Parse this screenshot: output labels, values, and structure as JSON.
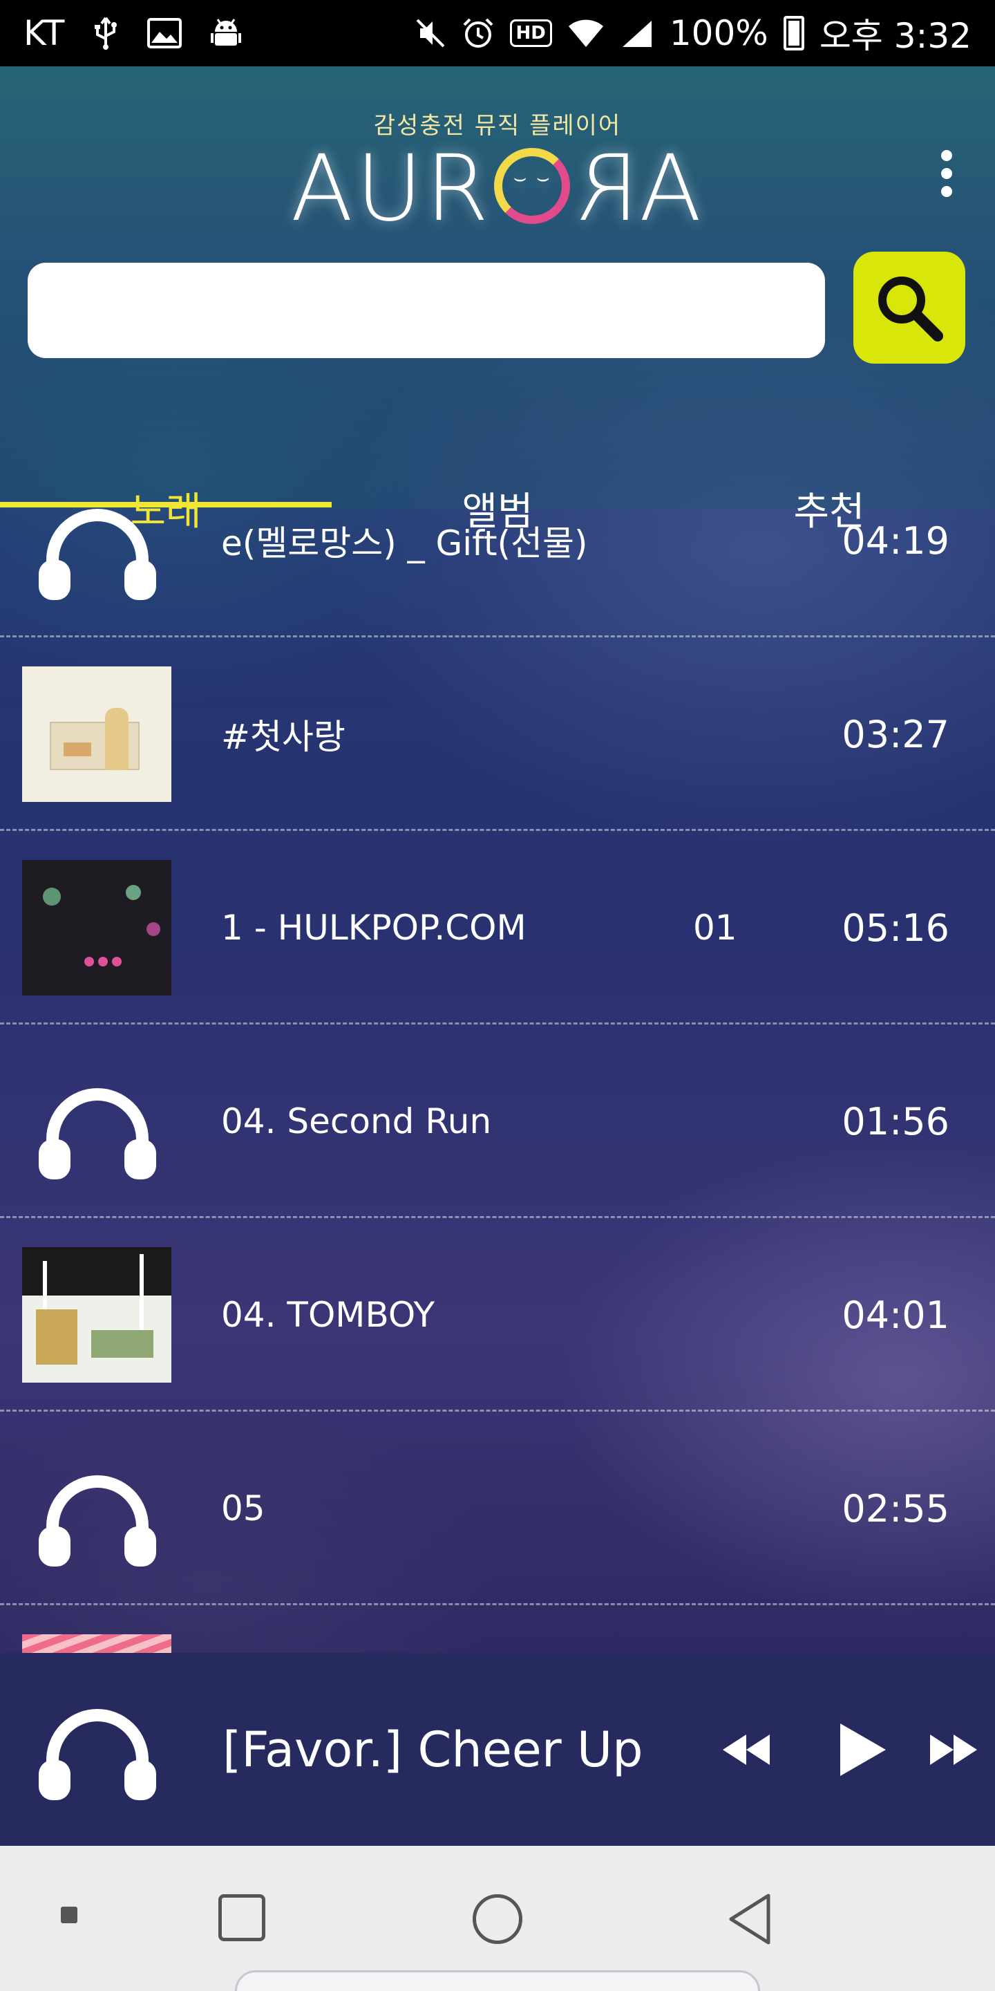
{
  "status_bar": {
    "carrier": "KT",
    "battery_percent": "100%",
    "time": "오후 3:32",
    "hd_label": "HD",
    "icons": [
      "usb-icon",
      "image-icon",
      "android-icon",
      "mute-icon",
      "alarm-icon",
      "hd-icon",
      "wifi-icon",
      "signal-icon",
      "battery-icon"
    ]
  },
  "header": {
    "subtitle": "감성충전 뮤직 플레이어",
    "logo_parts": [
      "AUR",
      "R",
      "A"
    ],
    "search": {
      "value": "",
      "placeholder": ""
    },
    "accent_color": "#d9e60a"
  },
  "tabs": [
    {
      "label": "노래",
      "active": true
    },
    {
      "label": "앨범",
      "active": false
    },
    {
      "label": "추천",
      "active": false
    }
  ],
  "songs": [
    {
      "title": "e(멜로망스) _ Gift(선물)",
      "extra": "",
      "duration": "04:19",
      "thumb": "headphones-icon"
    },
    {
      "title": "#첫사랑",
      "extra": "",
      "duration": "03:27",
      "thumb": "album-art-cream"
    },
    {
      "title": "1 - HULKPOP.COM",
      "extra": "01",
      "duration": "05:16",
      "thumb": "album-art-evening"
    },
    {
      "title": "04. Second Run",
      "extra": "",
      "duration": "01:56",
      "thumb": "headphones-icon"
    },
    {
      "title": "04. TOMBOY",
      "extra": "",
      "duration": "04:01",
      "thumb": "album-art-tomboy"
    },
    {
      "title": "05",
      "extra": "",
      "duration": "02:55",
      "thumb": "headphones-icon"
    },
    {
      "title": "",
      "extra": "",
      "duration": "",
      "thumb": "album-art-pink"
    }
  ],
  "player": {
    "title": "[Favor.] Cheer Up",
    "controls": [
      "rewind-icon",
      "play-icon",
      "fast-forward-icon"
    ]
  },
  "nav": [
    "recents-dot-icon",
    "overview-square-icon",
    "home-circle-icon",
    "back-triangle-icon"
  ]
}
